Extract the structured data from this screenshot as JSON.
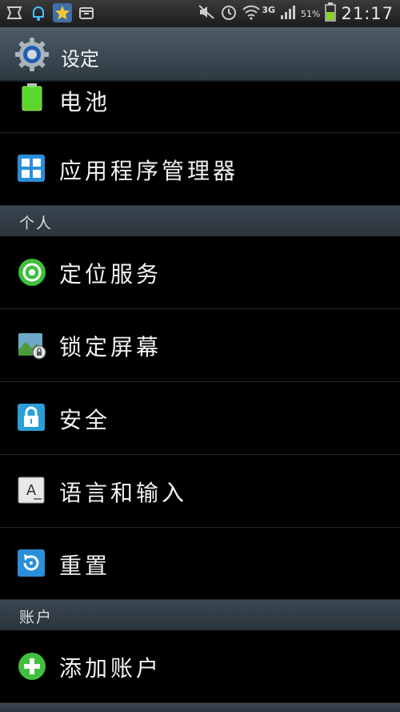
{
  "status_bar": {
    "network": "3G",
    "battery_percent": "51%",
    "time": "21:17"
  },
  "action_bar": {
    "title": "设定"
  },
  "items": {
    "battery": "电池",
    "app_manager": "应用程序管理器",
    "location": "定位服务",
    "lock_screen": "锁定屏幕",
    "security": "安全",
    "language_input": "语言和输入",
    "reset": "重置",
    "add_account": "添加账户"
  },
  "sections": {
    "personal": "个人",
    "accounts": "账户"
  },
  "colors": {
    "accent_green": "#3fbf3f",
    "accent_blue": "#2a8fd8",
    "header_bg": "#34404a"
  }
}
